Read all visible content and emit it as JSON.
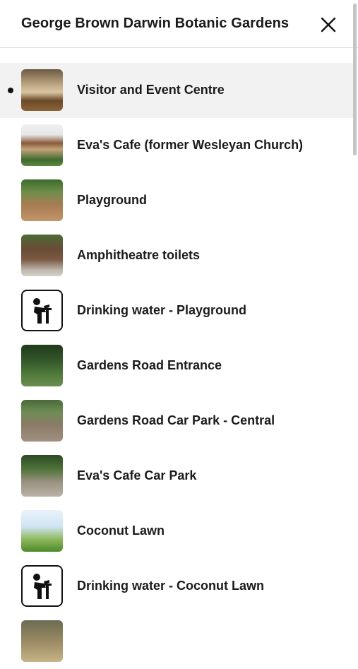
{
  "header": {
    "title": "George Brown Darwin Botanic Gardens",
    "close_icon": "close-icon"
  },
  "list": {
    "items": [
      {
        "label": "Visitor and Event Centre",
        "thumbnail": "photo",
        "selected": true
      },
      {
        "label": "Eva's Cafe (former Wesleyan Church)",
        "thumbnail": "photo"
      },
      {
        "label": "Playground",
        "thumbnail": "photo"
      },
      {
        "label": "Amphitheatre toilets",
        "thumbnail": "photo"
      },
      {
        "label": "Drinking water - Playground",
        "thumbnail": "drinking-water-icon"
      },
      {
        "label": "Gardens Road Entrance",
        "thumbnail": "photo"
      },
      {
        "label": "Gardens Road Car Park - Central",
        "thumbnail": "photo"
      },
      {
        "label": "Eva's Cafe Car Park",
        "thumbnail": "photo"
      },
      {
        "label": "Coconut Lawn",
        "thumbnail": "photo"
      },
      {
        "label": "Drinking water - Coconut Lawn",
        "thumbnail": "drinking-water-icon"
      }
    ]
  }
}
